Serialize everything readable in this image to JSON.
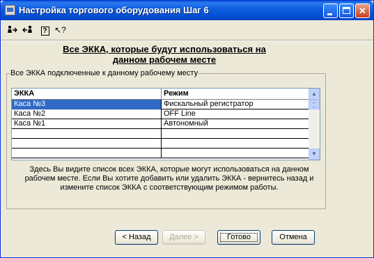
{
  "window": {
    "title": "Настройка торгового оборудования Шаг 6",
    "controls": {
      "minimize": "minimize-icon",
      "maximize": "maximize-icon",
      "close": "✕"
    }
  },
  "toolbar": {
    "icons": [
      "person-arrow-icon",
      "person-arrow-icon-2",
      "help-icon",
      "whats-this-icon"
    ],
    "help_glyph": "?",
    "whats_this_glyph": "↖?"
  },
  "heading": {
    "line1": "Все ЭККА, которые будут использоваться на",
    "line2": "данном рабочем месте"
  },
  "group": {
    "label": "Все ЭККА подключенные к данному рабочему месту"
  },
  "table": {
    "columns": [
      "ЭККА",
      "Режим"
    ],
    "rows": [
      {
        "ekka": "Каса №3",
        "mode": "Фискальный регистратор",
        "selected": true
      },
      {
        "ekka": "Каса №2",
        "mode": "OFF Line",
        "selected": false
      },
      {
        "ekka": "Каса №1",
        "mode": "Автономный",
        "selected": false
      },
      {
        "ekka": "",
        "mode": "",
        "selected": false
      },
      {
        "ekka": "",
        "mode": "",
        "selected": false
      },
      {
        "ekka": "",
        "mode": "",
        "selected": false
      }
    ],
    "scroll_up": "▲",
    "scroll_down": "▼"
  },
  "description": {
    "line1": "Здесь Вы видите список всех ЭККА, которые могут использоваться на данном",
    "line2": "рабочем месте. Если Вы хотите добавить или удалить ЭККА - вернитесь назад и",
    "line3": "измените список ЭККА с соответствующим режимом работы."
  },
  "buttons": {
    "back": "< Назад",
    "next": "Далее >",
    "done": "Готово",
    "cancel": "Отмена"
  },
  "colors": {
    "selection": "#316ac5",
    "titlebar": "#0653d8",
    "window_bg": "#ece9d8"
  }
}
